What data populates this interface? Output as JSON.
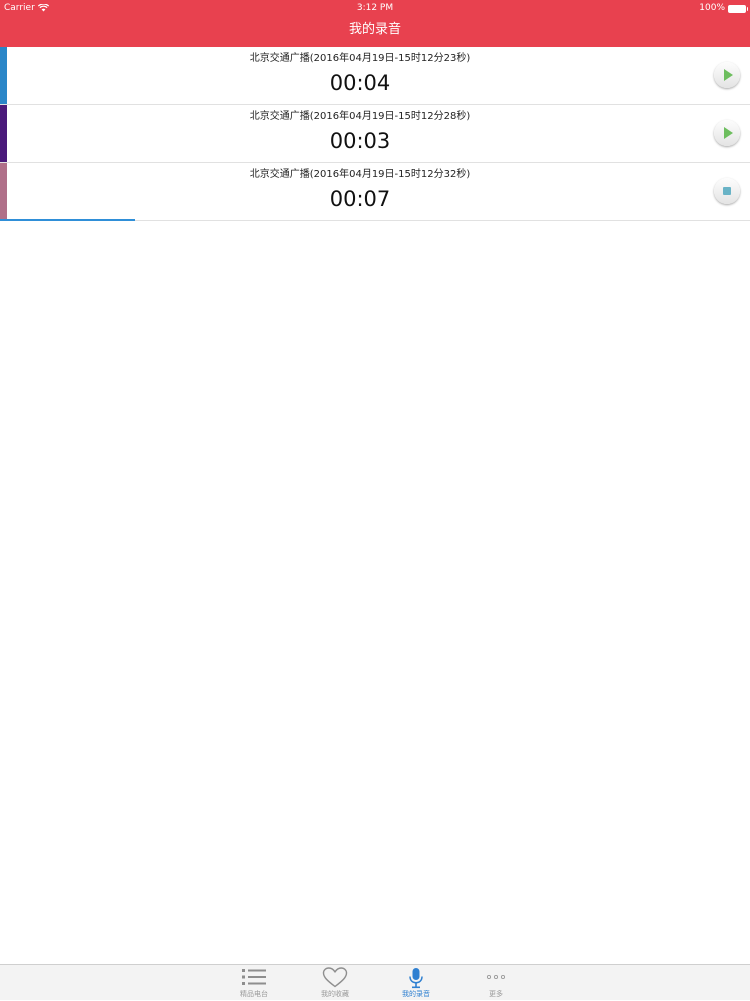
{
  "status_bar": {
    "carrier": "Carrier",
    "time": "3:12 PM",
    "battery": "100%"
  },
  "nav": {
    "title": "我的录音"
  },
  "recordings": [
    {
      "title": "北京交通广播(2016年04月19日-15时12分23秒)",
      "duration": "00:04",
      "color": "#2a86c8",
      "action": "play-icon"
    },
    {
      "title": "北京交通广播(2016年04月19日-15时12分28秒)",
      "duration": "00:03",
      "color": "#4a1a7a",
      "action": "play-icon"
    },
    {
      "title": "北京交通广播(2016年04月19日-15时12分32秒)",
      "duration": "00:07",
      "color": "#b07089",
      "action": "stop-icon",
      "progress": 0.18
    }
  ],
  "tabs": [
    {
      "label": "精品电台",
      "icon": "list-icon",
      "active": false
    },
    {
      "label": "我的收藏",
      "icon": "heart-icon",
      "active": false
    },
    {
      "label": "我的录音",
      "icon": "microphone-icon",
      "active": true
    },
    {
      "label": "更多",
      "icon": "more-dots-icon",
      "active": false
    }
  ],
  "colors": {
    "header": "#e8414f",
    "tab_active": "#2f80d1",
    "tab_inactive": "#9a9a9a",
    "progress": "#2f8fd8"
  }
}
